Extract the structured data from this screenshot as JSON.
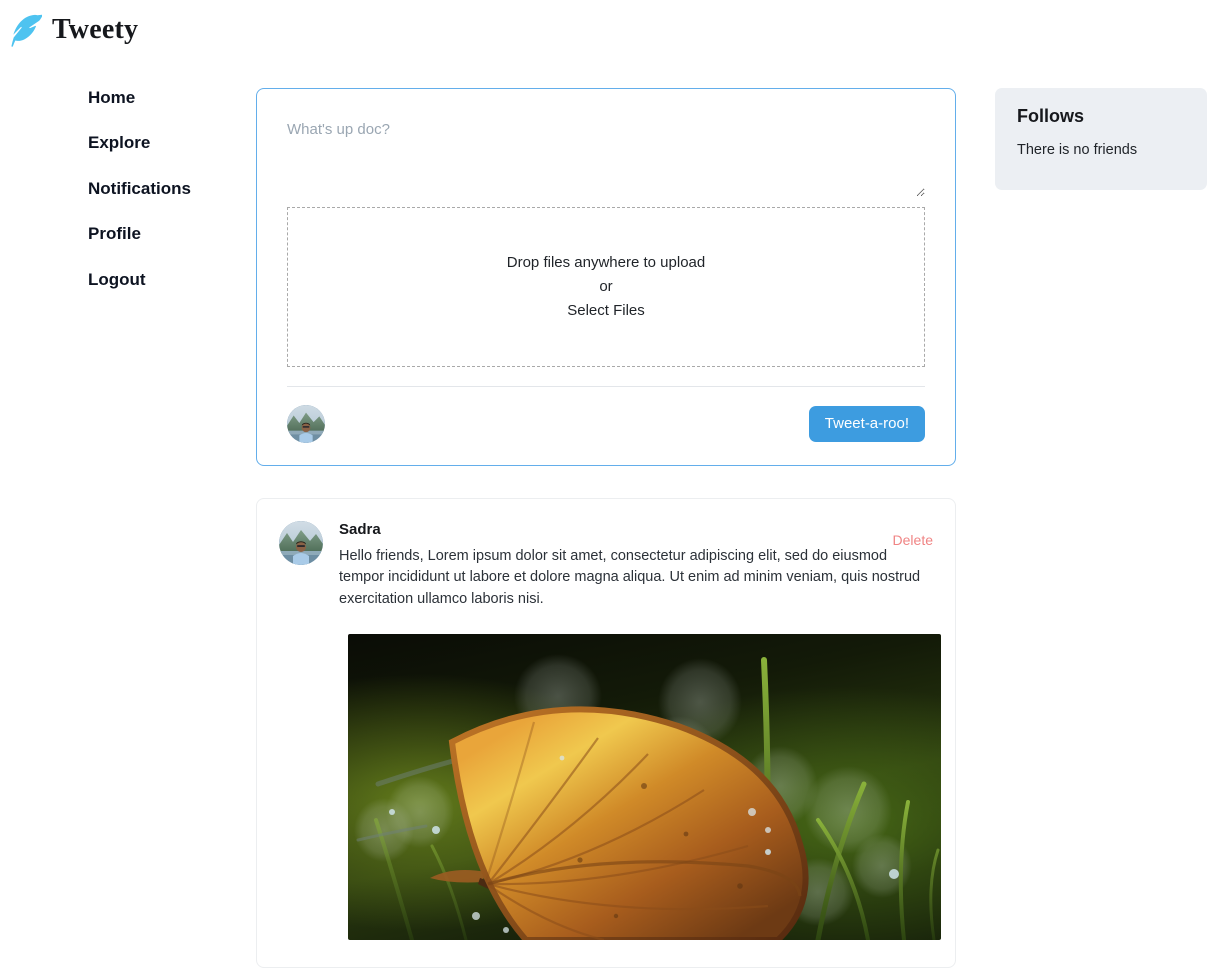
{
  "brand": {
    "title": "Tweety",
    "icon": "feather-icon",
    "icon_color": "#4ec3f0"
  },
  "sidebar": {
    "items": [
      {
        "label": "Home",
        "name": "sidebar-item-home"
      },
      {
        "label": "Explore",
        "name": "sidebar-item-explore"
      },
      {
        "label": "Notifications",
        "name": "sidebar-item-notifications"
      },
      {
        "label": "Profile",
        "name": "sidebar-item-profile"
      },
      {
        "label": "Logout",
        "name": "sidebar-item-logout"
      }
    ]
  },
  "compose": {
    "textarea_value": "",
    "textarea_placeholder": "What's up doc?",
    "dropzone": {
      "line1": "Drop files anywhere to upload",
      "line2": "or",
      "line3": "Select Files"
    },
    "submit_label": "Tweet-a-roo!",
    "submit_color": "#3d9ce0",
    "border_color": "#63aeeb",
    "avatar_alt": "user-avatar"
  },
  "feed": {
    "posts": [
      {
        "author": "Sadra",
        "delete_label": "Delete",
        "delete_color": "#f08484",
        "text": "Hello friends, Lorem ipsum dolor sit amet, consectetur adipiscing elit, sed do eiusmod tempor incididunt ut labore et dolore magna aliqua. Ut enim ad minim veniam, quis nostrud exercitation ullamco laboris nisi.",
        "image_alt": "autumn-leaf-on-grass-photo"
      }
    ]
  },
  "follows": {
    "title": "Follows",
    "empty_message": "There is no friends",
    "background": "#eceff3"
  }
}
